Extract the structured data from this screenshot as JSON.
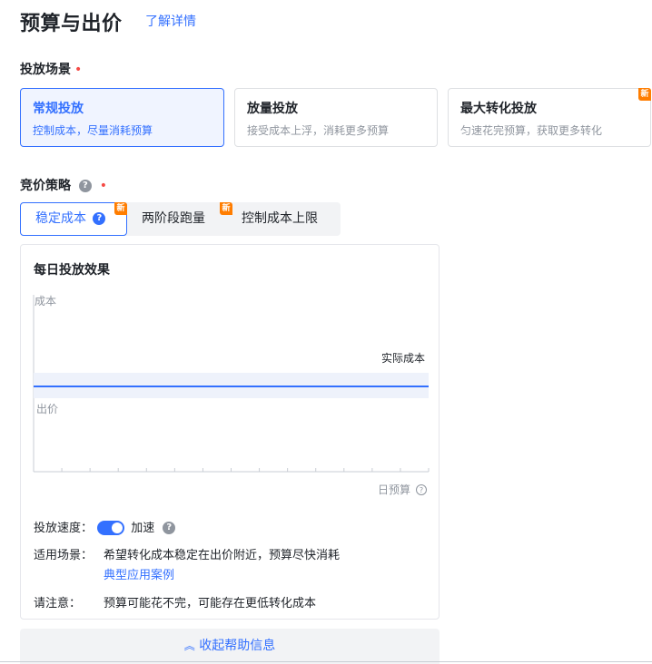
{
  "header": {
    "title": "预算与出价",
    "learn_more": "了解详情"
  },
  "scene": {
    "label": "投放场景",
    "required_mark": "•",
    "cards": [
      {
        "title": "常规投放",
        "desc": "控制成本，尽量消耗预算",
        "selected": true
      },
      {
        "title": "放量投放",
        "desc": "接受成本上浮，消耗更多预算",
        "selected": false
      },
      {
        "title": "最大转化投放",
        "desc": "匀速花完预算，获取更多转化",
        "selected": false,
        "badge": "新"
      }
    ]
  },
  "strategy": {
    "label": "竞价策略",
    "required_mark": "•",
    "help_icon": "question-icon",
    "tabs": [
      {
        "label": "稳定成本",
        "active": true,
        "badge": "新"
      },
      {
        "label": "两阶段跑量",
        "active": false,
        "badge": "新"
      },
      {
        "label": "控制成本上限",
        "active": false
      }
    ]
  },
  "panel": {
    "title": "每日投放效果",
    "chart": {
      "y_axis_label": "成本",
      "line_label": "实际成本",
      "band_label": "出价",
      "x_axis_label": "日预算"
    },
    "speed": {
      "label": "投放速度：",
      "value": "加速",
      "enabled": true
    },
    "scenario": {
      "label": "适用场景：",
      "text": "希望转化成本稳定在出价附近，预算尽快消耗",
      "link": "典型应用案例"
    },
    "notice": {
      "label": "请注意：",
      "text": "预算可能花不完，可能存在更低转化成本"
    }
  },
  "collapse": {
    "icon": "chevron-double-up-icon",
    "label": "收起帮助信息"
  },
  "colors": {
    "accent": "#3370ff",
    "badge": "#ff7d00",
    "required": "#f54a45"
  }
}
